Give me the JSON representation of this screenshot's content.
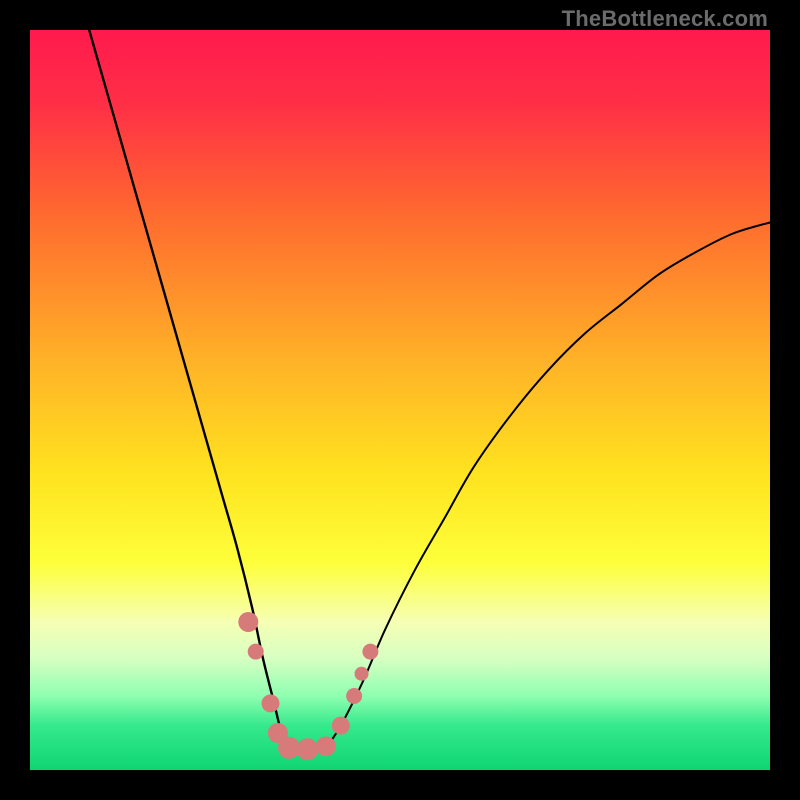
{
  "watermark": "TheBottleneck.com",
  "chart_data": {
    "type": "line",
    "title": "",
    "xlabel": "",
    "ylabel": "",
    "xlim": [
      0,
      100
    ],
    "ylim": [
      0,
      100
    ],
    "grid": false,
    "legend": false,
    "background_gradient": {
      "stops": [
        {
          "offset": 0.0,
          "color": "#ff1a4d"
        },
        {
          "offset": 0.1,
          "color": "#ff2f46"
        },
        {
          "offset": 0.25,
          "color": "#ff6a2f"
        },
        {
          "offset": 0.45,
          "color": "#ffb327"
        },
        {
          "offset": 0.6,
          "color": "#ffe31f"
        },
        {
          "offset": 0.72,
          "color": "#fdff3a"
        },
        {
          "offset": 0.8,
          "color": "#f6ffb4"
        },
        {
          "offset": 0.85,
          "color": "#d6ffc2"
        },
        {
          "offset": 0.9,
          "color": "#8effb0"
        },
        {
          "offset": 0.94,
          "color": "#35e98d"
        },
        {
          "offset": 1.0,
          "color": "#0fd571"
        }
      ]
    },
    "series": [
      {
        "name": "left-curve",
        "x": [
          8,
          10,
          12,
          14,
          16,
          18,
          20,
          22,
          24,
          26,
          28,
          30,
          31.5,
          33,
          34,
          35
        ],
        "y": [
          100,
          93,
          86,
          79,
          72,
          65,
          58,
          51,
          44,
          37,
          30,
          22,
          15,
          9,
          5,
          3
        ],
        "color": "#000000",
        "width": 2.4
      },
      {
        "name": "right-curve",
        "x": [
          40,
          42,
          45,
          48,
          52,
          56,
          60,
          65,
          70,
          75,
          80,
          85,
          90,
          95,
          100
        ],
        "y": [
          3,
          6,
          12,
          19,
          27,
          34,
          41,
          48,
          54,
          59,
          63,
          67,
          70,
          72.5,
          74
        ],
        "color": "#000000",
        "width": 2.0
      }
    ],
    "valley_floor": {
      "x_start": 35,
      "x_end": 40,
      "y": 3
    },
    "markers": {
      "color": "#d77a7a",
      "points": [
        {
          "x": 29.5,
          "y": 20,
          "r": 10
        },
        {
          "x": 30.5,
          "y": 16,
          "r": 8
        },
        {
          "x": 32.5,
          "y": 9,
          "r": 9
        },
        {
          "x": 33.5,
          "y": 5,
          "r": 10
        },
        {
          "x": 35.0,
          "y": 3,
          "r": 11
        },
        {
          "x": 37.5,
          "y": 2.8,
          "r": 11
        },
        {
          "x": 40.0,
          "y": 3.2,
          "r": 10
        },
        {
          "x": 42.0,
          "y": 6,
          "r": 9
        },
        {
          "x": 43.8,
          "y": 10,
          "r": 8
        },
        {
          "x": 44.8,
          "y": 13,
          "r": 7
        },
        {
          "x": 46.0,
          "y": 16,
          "r": 8
        }
      ]
    }
  }
}
